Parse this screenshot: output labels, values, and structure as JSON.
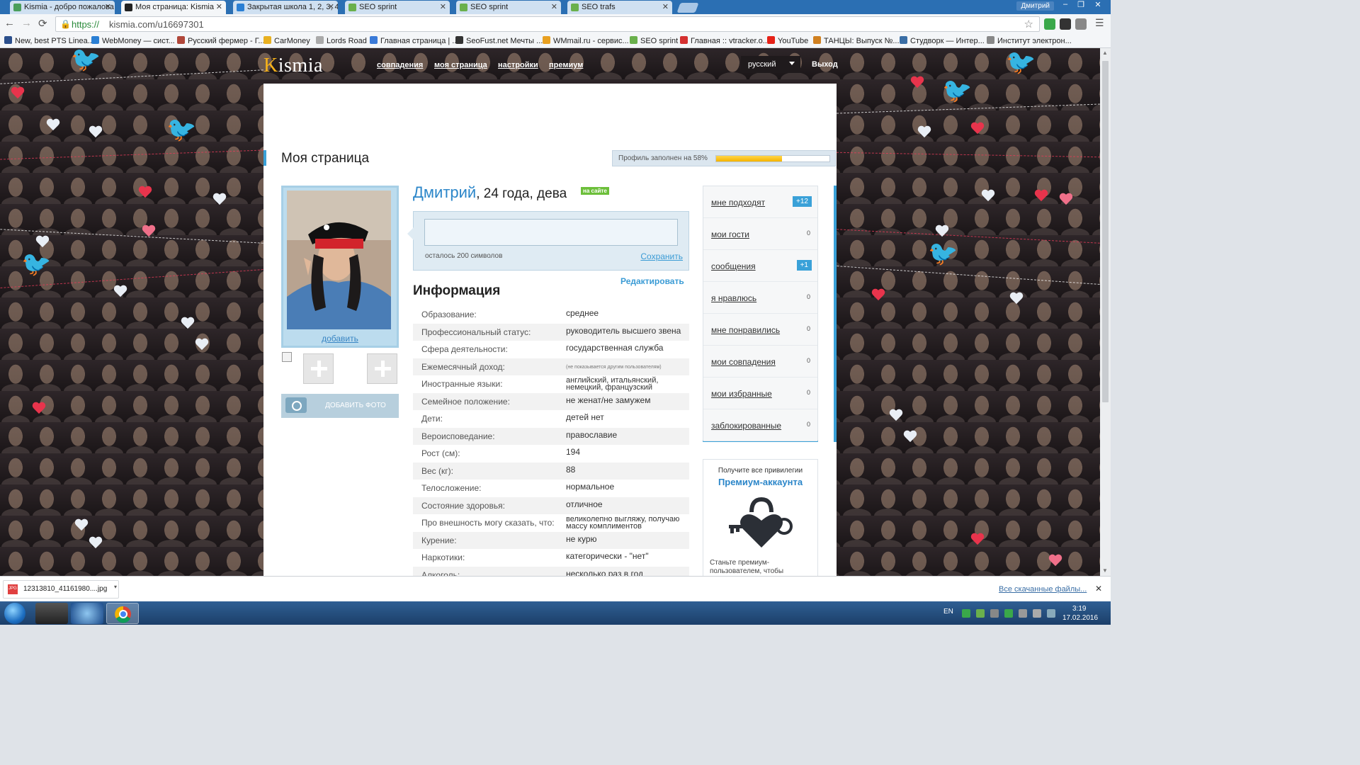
{
  "browser": {
    "tabs": [
      {
        "title": "Kismia - добро пожалова",
        "active": false,
        "icon_color": "#4a9e5c"
      },
      {
        "title": "Моя страница: Kismia",
        "active": true,
        "icon_color": "#222222"
      },
      {
        "title": "Закрытая школа 1, 2, 3, 4",
        "active": false,
        "icon_color": "#2a7fd4"
      },
      {
        "title": "SEO sprint",
        "active": false,
        "icon_color": "#6ab04c"
      },
      {
        "title": "SEO sprint",
        "active": false,
        "icon_color": "#6ab04c"
      },
      {
        "title": "SEO trafs",
        "active": false,
        "icon_color": "#6ab04c"
      }
    ],
    "user": "Дмитрий",
    "window_buttons": [
      "–",
      "❐",
      "✕"
    ],
    "url_scheme": "https://",
    "url_rest": "kismia.com/u16697301",
    "nav": {
      "back": "←",
      "forward": "→",
      "reload": "⟳"
    },
    "bookmarks": [
      {
        "label": "New, best PTS Linea...",
        "color": "#2b4f8c"
      },
      {
        "label": "WebMoney — сист...",
        "color": "#2a7fd4"
      },
      {
        "label": "Русский фермер - Г...",
        "color": "#b0473a"
      },
      {
        "label": "CarMoney",
        "color": "#e8b020"
      },
      {
        "label": "Lords Road",
        "color": "#aaaaaa"
      },
      {
        "label": "Главная страница | ...",
        "color": "#3a7ad8"
      },
      {
        "label": "SeoFust.net Мечты ...",
        "color": "#333333"
      },
      {
        "label": "WMmail.ru - сервис...",
        "color": "#e8a020"
      },
      {
        "label": "SEO sprint",
        "color": "#6ab04c"
      },
      {
        "label": "Главная :: vtracker.o...",
        "color": "#d43030"
      },
      {
        "label": "YouTube",
        "color": "#e62117"
      },
      {
        "label": "ТАНЦЫ: Выпуск №...",
        "color": "#d08020"
      },
      {
        "label": "Студворк — Интер...",
        "color": "#3a6ea5"
      },
      {
        "label": "Институт электрон...",
        "color": "#888888"
      }
    ]
  },
  "site": {
    "logo_first": "K",
    "logo_rest": "ismia",
    "nav": [
      "совпадения",
      "моя страница",
      "настройки",
      "премиум"
    ],
    "language": "русский",
    "logout": "Выход"
  },
  "page": {
    "title": "Моя страница",
    "profile_fill_label": "Профиль заполнен на 58%",
    "profile_fill": 0.58
  },
  "photo": {
    "add_link": "добавить",
    "add_photo_button": "ДОБАВИТЬ ФОТО"
  },
  "profile": {
    "name": "Дмитрий",
    "rest": ", 24 года, дева",
    "online_badge": "на сайте",
    "status_placeholder": "",
    "chars_left": "осталось 200 символов",
    "save": "Сохранить",
    "edit": "Редактировать",
    "info_heading": "Информация",
    "info": [
      {
        "k": "Образование:",
        "v": "среднее"
      },
      {
        "k": "Профессиональный статус:",
        "v": "руководитель высшего звена"
      },
      {
        "k": "Сфера деятельности:",
        "v": "государственная служба"
      },
      {
        "k": "Ежемесячный доход:",
        "v": "(не показывается другим пользователям)",
        "style": "small"
      },
      {
        "k": "Иностранные языки:",
        "v": "английский, итальянский, немецкий, французский",
        "style": "two"
      },
      {
        "k": "Семейное положение:",
        "v": "не женат/не замужем"
      },
      {
        "k": "Дети:",
        "v": "детей нет"
      },
      {
        "k": "Вероисповедание:",
        "v": "православие"
      },
      {
        "k": "Рост (см):",
        "v": "194"
      },
      {
        "k": "Вес (кг):",
        "v": "88"
      },
      {
        "k": "Телосложение:",
        "v": "нормальное"
      },
      {
        "k": "Состояние здоровья:",
        "v": "отличное"
      },
      {
        "k": "Про внешность могу сказать, что:",
        "v": "великолепно выгляжу, получаю массу комплиментов",
        "style": "two"
      },
      {
        "k": "Курение:",
        "v": "не курю"
      },
      {
        "k": "Наркотики:",
        "v": "категорически - \"нет\""
      },
      {
        "k": "Алкоголь:",
        "v": "несколько раз в год"
      }
    ]
  },
  "side_menu": [
    {
      "label": "мне подходят",
      "count": "+12",
      "badge": true
    },
    {
      "label": "мои гости",
      "count": "0",
      "badge": false
    },
    {
      "label": "сообщения",
      "count": "+1",
      "badge": true
    },
    {
      "label": "я нравлюсь",
      "count": "0",
      "badge": false
    },
    {
      "label": "мне понравились",
      "count": "0",
      "badge": false
    },
    {
      "label": "мои совпадения",
      "count": "0",
      "badge": false
    },
    {
      "label": "мои избранные",
      "count": "0",
      "badge": false
    },
    {
      "label": "заблокированные",
      "count": "0",
      "badge": false
    }
  ],
  "premium": {
    "line1": "Получите все привилегии",
    "line2": "Премиум-аккаунта",
    "line3": "Станьте премиум-пользователем, чтобы"
  },
  "downloads": {
    "icon": "JPG",
    "file": "12313810_41161980....jpg",
    "show_all": "Все скачанные файлы..."
  },
  "taskbar": {
    "lang": "EN",
    "time": "3:19",
    "date": "17.02.2016"
  },
  "colors": {
    "accent": "#3aa1d8",
    "name_blue": "#2b86c9",
    "online_green": "#6cbf3a",
    "progress_yellow": "#f5b400"
  }
}
